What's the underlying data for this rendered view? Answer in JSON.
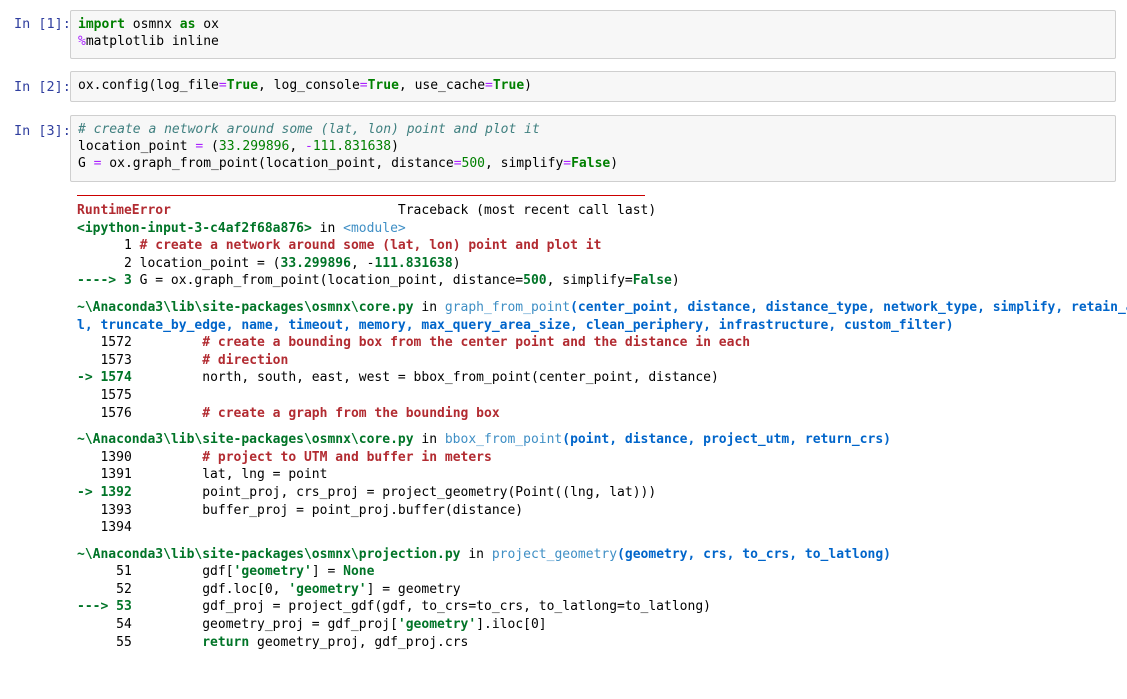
{
  "cells": [
    {
      "prompt": "In [1]:",
      "lines": [
        [
          [
            "kw",
            "import"
          ],
          [
            "t",
            " osmnx "
          ],
          [
            "kw",
            "as"
          ],
          [
            "t",
            " ox"
          ]
        ],
        [
          [
            "mg",
            "%"
          ],
          [
            "t",
            "matplotlib inline"
          ]
        ]
      ]
    },
    {
      "prompt": "In [2]:",
      "lines": [
        [
          [
            "t",
            "ox.config(log_file"
          ],
          [
            "op",
            "="
          ],
          [
            "kw",
            "True"
          ],
          [
            "t",
            ", log_console"
          ],
          [
            "op",
            "="
          ],
          [
            "kw",
            "True"
          ],
          [
            "t",
            ", use_cache"
          ],
          [
            "op",
            "="
          ],
          [
            "kw",
            "True"
          ],
          [
            "t",
            ")"
          ]
        ]
      ]
    },
    {
      "prompt": "In [3]:",
      "lines": [
        [
          [
            "cm",
            "# create a network around some (lat, lon) point and plot it"
          ]
        ],
        [
          [
            "t",
            "location_point "
          ],
          [
            "op",
            "="
          ],
          [
            "t",
            " ("
          ],
          [
            "num",
            "33.299896"
          ],
          [
            "t",
            ", "
          ],
          [
            "op",
            "-"
          ],
          [
            "num",
            "111.831638"
          ],
          [
            "t",
            ")"
          ]
        ],
        [
          [
            "t",
            "G "
          ],
          [
            "op",
            "="
          ],
          [
            "t",
            " ox.graph_from_point(location_point, distance"
          ],
          [
            "op",
            "="
          ],
          [
            "num",
            "500"
          ],
          [
            "t",
            ", simplify"
          ],
          [
            "op",
            "="
          ],
          [
            "kw",
            "False"
          ],
          [
            "t",
            ")"
          ]
        ]
      ]
    }
  ],
  "traceback": [
    [
      [
        "red",
        "RuntimeError"
      ],
      [
        "t",
        "                             Traceback (most recent call last)"
      ]
    ],
    [
      [
        "grn",
        "<ipython-input-3-c4af2f68a876>"
      ],
      [
        "t",
        " in "
      ],
      [
        "cya",
        "<module>"
      ]
    ],
    [
      [
        "t",
        "      1 "
      ],
      [
        "red",
        "# create a network around some (lat, lon) point and plot it"
      ]
    ],
    [
      [
        "t",
        "      2 location_point = ("
      ],
      [
        "grn",
        "33.299896"
      ],
      [
        "t",
        ", -"
      ],
      [
        "grn",
        "111.831638"
      ],
      [
        "t",
        ")"
      ]
    ],
    [
      [
        "grn",
        "----> 3"
      ],
      [
        "t",
        " G = ox.graph_from_point(location_point, distance="
      ],
      [
        "grn",
        "500"
      ],
      [
        "t",
        ", simplify="
      ],
      [
        "grn",
        "False"
      ],
      [
        "t",
        ")"
      ]
    ],
    [
      [
        "gap",
        ""
      ]
    ],
    [
      [
        "grn",
        "~\\Anaconda3\\lib\\site-packages\\osmnx\\core.py"
      ],
      [
        "t",
        " in "
      ],
      [
        "cya",
        "graph_from_point"
      ],
      [
        "blu",
        "(center_point, distance, distance_type, network_type, simplify, retain_al"
      ]
    ],
    [
      [
        "blu",
        "l, truncate_by_edge, name, timeout, memory, max_query_area_size, clean_periphery, infrastructure, custom_filter)"
      ]
    ],
    [
      [
        "t",
        "   1572         "
      ],
      [
        "red",
        "# create a bounding box from the center point and the distance in each"
      ]
    ],
    [
      [
        "t",
        "   1573         "
      ],
      [
        "red",
        "# direction"
      ]
    ],
    [
      [
        "grn",
        "-> 1574"
      ],
      [
        "t",
        "         north, south, east, west = bbox_from_point(center_point, distance)"
      ]
    ],
    [
      [
        "t",
        "   1575"
      ]
    ],
    [
      [
        "t",
        "   1576         "
      ],
      [
        "red",
        "# create a graph from the bounding box"
      ]
    ],
    [
      [
        "gap",
        ""
      ]
    ],
    [
      [
        "grn",
        "~\\Anaconda3\\lib\\site-packages\\osmnx\\core.py"
      ],
      [
        "t",
        " in "
      ],
      [
        "cya",
        "bbox_from_point"
      ],
      [
        "blu",
        "(point, distance, project_utm, return_crs)"
      ]
    ],
    [
      [
        "t",
        "   1390         "
      ],
      [
        "red",
        "# project to UTM and buffer in meters"
      ]
    ],
    [
      [
        "t",
        "   1391         lat, lng = point"
      ]
    ],
    [
      [
        "grn",
        "-> 1392"
      ],
      [
        "t",
        "         point_proj, crs_proj = project_geometry(Point((lng, lat)))"
      ]
    ],
    [
      [
        "t",
        "   1393         buffer_proj = point_proj.buffer(distance)"
      ]
    ],
    [
      [
        "t",
        "   1394"
      ]
    ],
    [
      [
        "gap",
        ""
      ]
    ],
    [
      [
        "grn",
        "~\\Anaconda3\\lib\\site-packages\\osmnx\\projection.py"
      ],
      [
        "t",
        " in "
      ],
      [
        "cya",
        "project_geometry"
      ],
      [
        "blu",
        "(geometry, crs, to_crs, to_latlong)"
      ]
    ],
    [
      [
        "t",
        "     51         gdf["
      ],
      [
        "grn",
        "'geometry'"
      ],
      [
        "t",
        "] = "
      ],
      [
        "grn",
        "None"
      ]
    ],
    [
      [
        "t",
        "     52         gdf.loc[0, "
      ],
      [
        "grn",
        "'geometry'"
      ],
      [
        "t",
        "] = geometry"
      ]
    ],
    [
      [
        "grn",
        "---> 53"
      ],
      [
        "t",
        "         gdf_proj = project_gdf(gdf, to_crs=to_crs, to_latlong=to_latlong)"
      ]
    ],
    [
      [
        "t",
        "     54         geometry_proj = gdf_proj["
      ],
      [
        "grn",
        "'geometry'"
      ],
      [
        "t",
        "].iloc[0]"
      ]
    ],
    [
      [
        "t",
        "     55         "
      ],
      [
        "grn",
        "return"
      ],
      [
        "t",
        " geometry_proj, gdf_proj.crs"
      ]
    ]
  ]
}
